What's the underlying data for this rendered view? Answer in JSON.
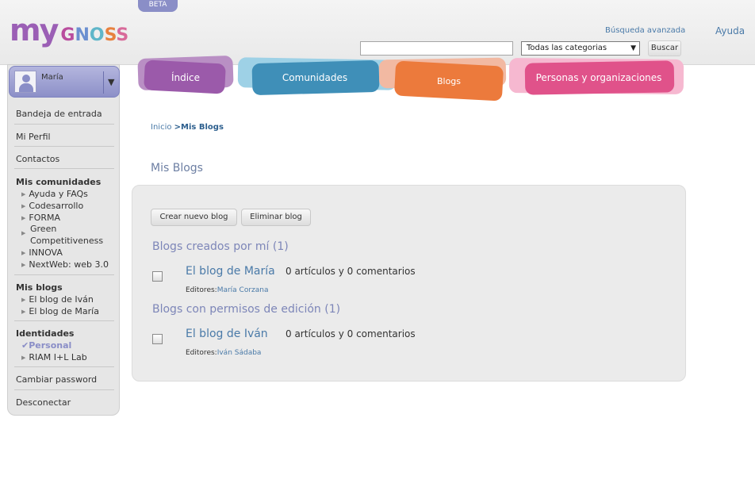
{
  "header": {
    "logo_my": "my",
    "logo_gnoss": [
      "G",
      "N",
      "O",
      "S",
      "S"
    ],
    "beta": "BETA",
    "advanced_search": "Búsqueda avanzada",
    "help": "Ayuda",
    "search_placeholder": "",
    "category_selected": "Todas las categorias",
    "search_button": "Buscar"
  },
  "tabs": [
    {
      "label": "Índice",
      "color": "#9b5aaa"
    },
    {
      "label": "Comunidades",
      "color": "#3f8fb8"
    },
    {
      "label": "Blogs",
      "color": "#ec7a3c"
    },
    {
      "label": "Personas y organizaciones",
      "color": "#e0528a"
    }
  ],
  "sidebar": {
    "user_name": "María",
    "inbox": "Bandeja de entrada",
    "profile": "Mi Perfil",
    "contacts": "Contactos",
    "communities_title": "Mis comunidades",
    "communities": [
      "Ayuda y FAQs",
      "Codesarrollo",
      "FORMA",
      "Green Competitiveness",
      "INNOVA",
      "NextWeb: web 3.0"
    ],
    "blogs_title": "Mis blogs",
    "blogs": [
      "El blog de Iván",
      "El blog de María"
    ],
    "identities_title": "Identidades",
    "identity_current": "Personal",
    "identity_other": "RIAM I+L Lab",
    "change_password": "Cambiar password",
    "logout": "Desconectar"
  },
  "breadcrumb": {
    "home": "Inicio",
    "separator": ">",
    "current": "Mis Blogs"
  },
  "page_title": "Mis Blogs",
  "actions": {
    "create": "Crear nuevo blog",
    "delete": "Eliminar blog"
  },
  "sections": [
    {
      "title": "Blogs creados por mí (1)",
      "blog_name": "El blog de María",
      "stats": "0 artículos y 0 comentarios",
      "editors_label": "Editores:",
      "editors": "María Corzana"
    },
    {
      "title": "Blogs con permisos de edición (1)",
      "blog_name": "El blog de Iván",
      "stats": "0 artículos y 0 comentarios",
      "editors_label": "Editores:",
      "editors": "Iván Sádaba"
    }
  ]
}
